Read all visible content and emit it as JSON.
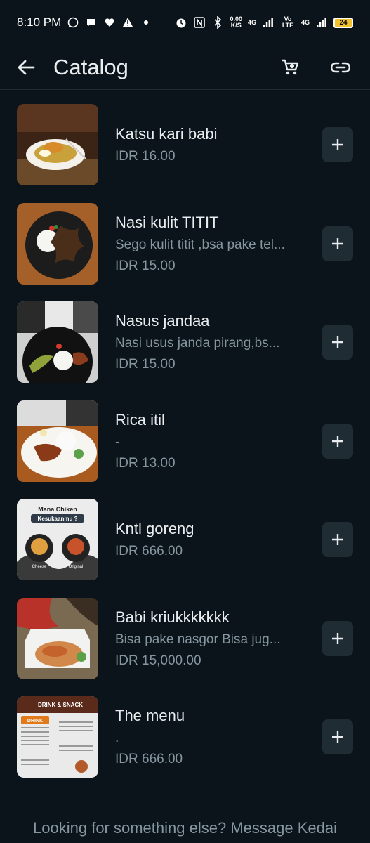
{
  "status_bar": {
    "time": "8:10 PM",
    "net_speed_value": "0.00",
    "net_speed_unit": "K/S",
    "signal_1": "4G",
    "volte": "Vo LTE",
    "signal_2": "4G",
    "battery": "24"
  },
  "header": {
    "title": "Catalog"
  },
  "items": [
    {
      "name": "Katsu kari babi",
      "description": "",
      "price": "IDR 16.00"
    },
    {
      "name": "Nasi kulit TITIT",
      "description": "Sego kulit titit ,bsa pake tel...",
      "price": "IDR 15.00"
    },
    {
      "name": "Nasus jandaa",
      "description": "Nasi usus janda pirang,bs...",
      "price": "IDR 15.00"
    },
    {
      "name": "Rica itil",
      "description": "-",
      "price": "IDR 13.00"
    },
    {
      "name": "Kntl goreng",
      "description": "",
      "price": "IDR 666.00"
    },
    {
      "name": "Babi kriukkkkkkk",
      "description": "Bisa pake nasgor Bisa jug...",
      "price": "IDR 15,000.00"
    },
    {
      "name": "The menu",
      "description": ".",
      "price": "IDR 666.00"
    }
  ],
  "thumbnail_text": {
    "item5_title": "Mana Chiken",
    "item5_subtitle": "Kesukaanmu ?",
    "item5_label_left": "Cheese",
    "item5_label_right": "Original",
    "item7_title": "DRINK & SNACK",
    "item7_section": "DRINK"
  },
  "footer": {
    "text": "Looking for something else? Message Kedai"
  },
  "colors": {
    "background": "#0b141a",
    "button_bg": "#202c33",
    "secondary_text": "#8696a0",
    "primary_text": "#e9edef"
  }
}
